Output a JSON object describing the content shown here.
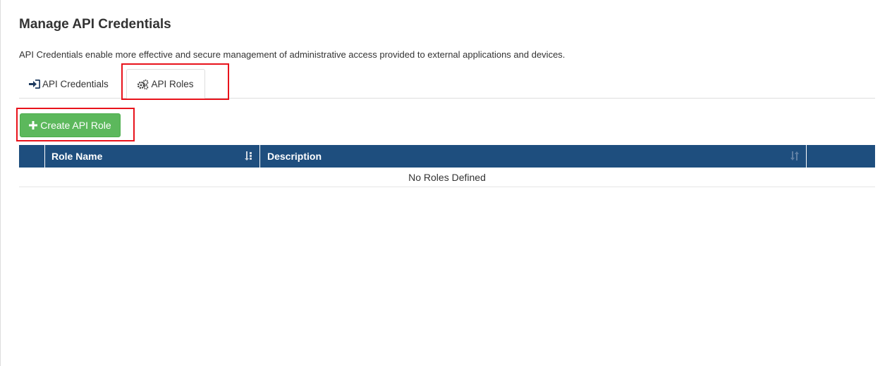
{
  "page": {
    "title": "Manage API Credentials",
    "description": "API Credentials enable more effective and secure management of administrative access provided to external applications and devices."
  },
  "tabs": [
    {
      "label": "API Credentials",
      "icon": "sign-in-icon",
      "active": false
    },
    {
      "label": "API Roles",
      "icon": "cogs-icon",
      "active": true
    }
  ],
  "toolbar": {
    "create_label": "Create API Role",
    "create_icon": "plus-icon"
  },
  "table": {
    "columns": [
      {
        "label": "",
        "sort": "none"
      },
      {
        "label": "Role Name",
        "sort": "sorted"
      },
      {
        "label": "Description",
        "sort": "sortable"
      },
      {
        "label": "",
        "sort": "none"
      }
    ],
    "empty_message": "No Roles Defined"
  },
  "colors": {
    "header_bg": "#1e4e7e",
    "button_bg": "#5cb85c",
    "highlight": "#e8121b"
  }
}
